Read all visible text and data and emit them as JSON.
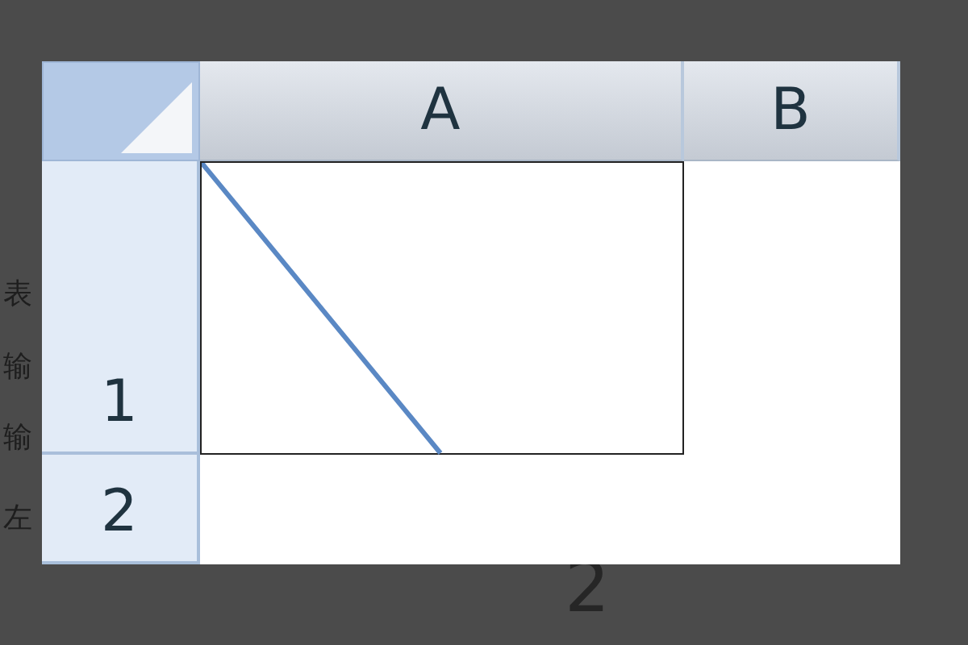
{
  "background_text": [
    "表",
    "输",
    "输",
    "左"
  ],
  "background_row_number": "2",
  "sheet": {
    "columns": [
      "A",
      "B"
    ],
    "first_cell_diagonal": true,
    "rows": [
      {
        "number": "1"
      },
      {
        "number": "2"
      }
    ]
  }
}
